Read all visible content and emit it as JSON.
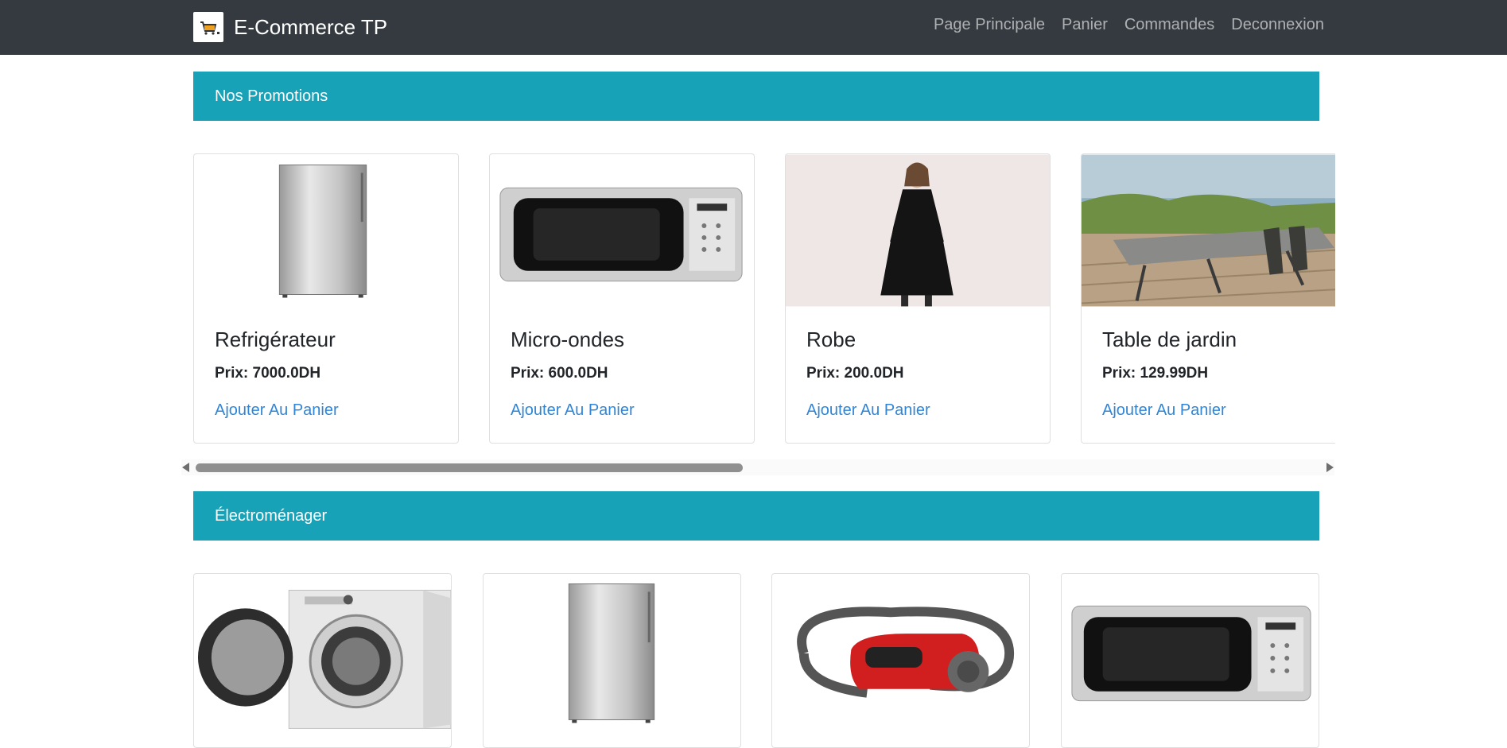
{
  "navbar": {
    "brand": "E-Commerce TP",
    "links": [
      "Page Principale",
      "Panier",
      "Commandes",
      "Deconnexion"
    ]
  },
  "promotions": {
    "title": "Nos Promotions",
    "products": [
      {
        "name": "Refrigérateur",
        "price": "Prix: 7000.0DH",
        "action": "Ajouter Au Panier",
        "icon": "refrigerator-image"
      },
      {
        "name": "Micro-ondes",
        "price": "Prix: 600.0DH",
        "action": "Ajouter Au Panier",
        "icon": "microwave-image"
      },
      {
        "name": "Robe",
        "price": "Prix: 200.0DH",
        "action": "Ajouter Au Panier",
        "icon": "dress-image"
      },
      {
        "name": "Table de jardin",
        "price": "Prix: 129.99DH",
        "action": "Ajouter Au Panier",
        "icon": "garden-table-image"
      }
    ]
  },
  "appliances": {
    "title": "Électroménager",
    "products": [
      {
        "icon": "washing-machine-image"
      },
      {
        "icon": "refrigerator-image"
      },
      {
        "icon": "vacuum-cleaner-image"
      },
      {
        "icon": "microwave-image"
      }
    ]
  },
  "colors": {
    "navbar": "#343a40",
    "section_header": "#17a2b8",
    "link": "#2f86d8"
  }
}
